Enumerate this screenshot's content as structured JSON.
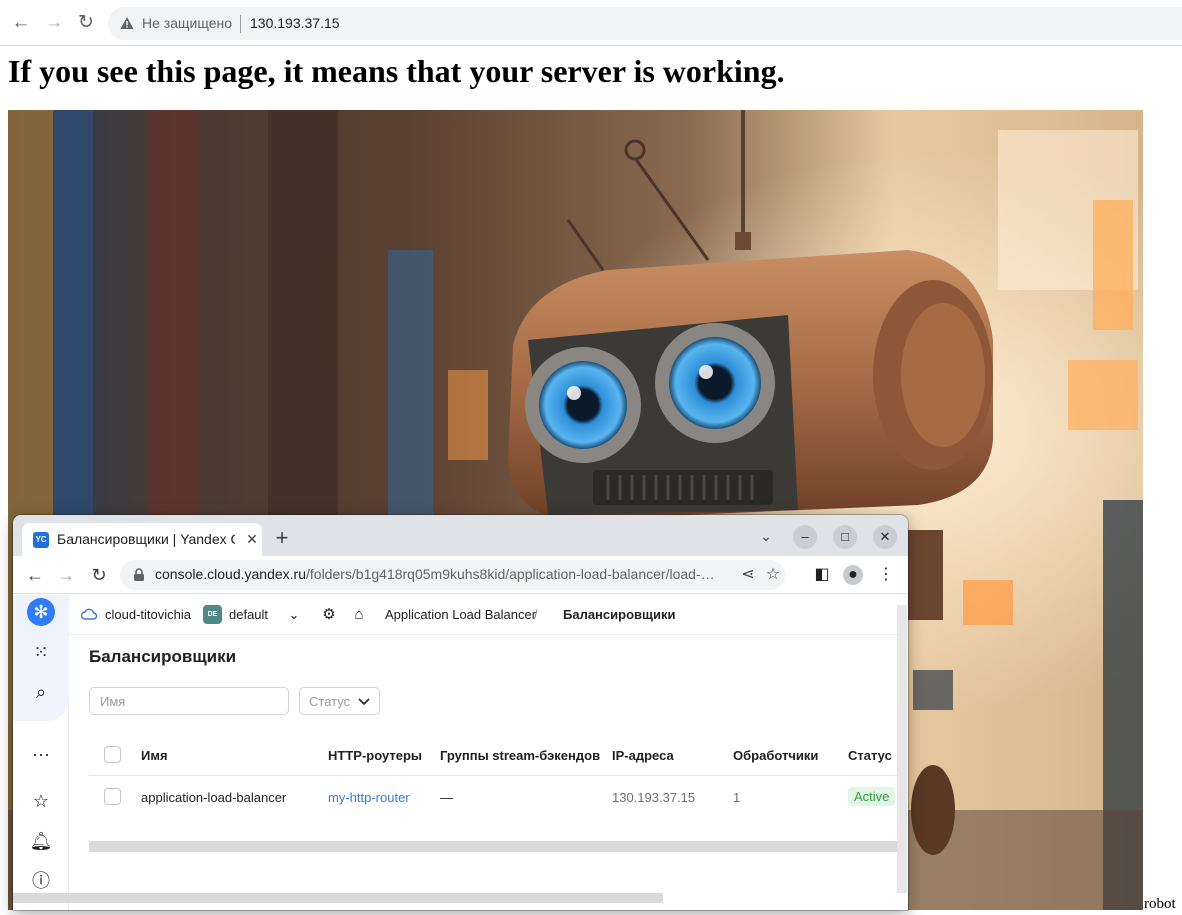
{
  "outer_browser": {
    "security_label": "Не защищено",
    "url": "130.193.37.15"
  },
  "page": {
    "heading": "If you see this page, it means that your server is working.",
    "image_alt": "robot"
  },
  "inner_browser": {
    "tab": {
      "favicon_text": "YC",
      "title": "Балансировщики | Yandex Cloud"
    },
    "url_host": "console.cloud.yandex.ru",
    "url_path": "/folders/b1g418rq05m9kuhs8kid/application-load-balancer/load-…"
  },
  "console": {
    "breadcrumbs": {
      "cloud": "cloud-titovichia",
      "folder_badge": "DE",
      "folder": "default",
      "service": "Application Load Balancer",
      "separator": "/",
      "current": "Балансировщики"
    },
    "title": "Балансировщики",
    "filters": {
      "name_placeholder": "Имя",
      "status_label": "Статус"
    },
    "table": {
      "columns": [
        "Имя",
        "HTTP-роутеры",
        "Группы stream-бэкендов",
        "IP-адреса",
        "Обработчики",
        "Статус"
      ],
      "rows": [
        {
          "name": "application-load-balancer",
          "http_router": "my-http-router",
          "stream_groups": "—",
          "ip": "130.193.37.15",
          "listeners": "1",
          "status": "Active"
        }
      ]
    }
  },
  "colors": {
    "accent_blue": "#2f7cf6",
    "link": "#3a78d6",
    "status_active_text": "#2d9d45",
    "status_active_bg": "#e3f5e7"
  }
}
